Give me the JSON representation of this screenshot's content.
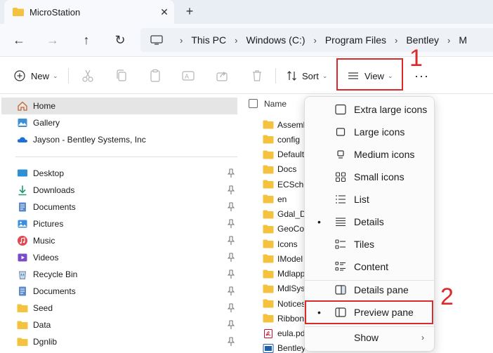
{
  "tab": {
    "title": "MicroStation",
    "close": "✕",
    "new_tab": "+"
  },
  "nav": {
    "back": "←",
    "forward": "→",
    "up": "↑",
    "refresh": "↻"
  },
  "breadcrumbs": [
    "This PC",
    "Windows (C:)",
    "Program Files",
    "Bentley",
    "M"
  ],
  "toolbar": {
    "new_label": "New",
    "sort_label": "Sort",
    "view_label": "View",
    "more_label": "···"
  },
  "annotations": {
    "step1": "1",
    "step2": "2"
  },
  "navpane": {
    "items": [
      {
        "label": "Home",
        "icon": "home-icon",
        "selected": true,
        "pinned": false
      },
      {
        "label": "Gallery",
        "icon": "gallery-icon",
        "pinned": false
      },
      {
        "label": "Jayson - Bentley Systems, Inc",
        "icon": "onedrive-icon",
        "pinned": false
      },
      {
        "label": "Desktop",
        "icon": "desktop-icon",
        "pinned": true
      },
      {
        "label": "Downloads",
        "icon": "downloads-icon",
        "pinned": true
      },
      {
        "label": "Documents",
        "icon": "documents-icon",
        "pinned": true
      },
      {
        "label": "Pictures",
        "icon": "pictures-icon",
        "pinned": true
      },
      {
        "label": "Music",
        "icon": "music-icon",
        "pinned": true
      },
      {
        "label": "Videos",
        "icon": "videos-icon",
        "pinned": true
      },
      {
        "label": "Recycle Bin",
        "icon": "recycle-bin-icon",
        "pinned": true
      },
      {
        "label": "Documents",
        "icon": "documents-icon",
        "pinned": true
      },
      {
        "label": "Seed",
        "icon": "folder-icon",
        "pinned": true
      },
      {
        "label": "Data",
        "icon": "folder-icon",
        "pinned": true
      },
      {
        "label": "Dgnlib",
        "icon": "folder-icon",
        "pinned": true
      }
    ]
  },
  "filelist": {
    "header": "Name",
    "rows": [
      {
        "name": "Assemb",
        "icon": "folder-icon"
      },
      {
        "name": "config",
        "icon": "folder-icon"
      },
      {
        "name": "Default",
        "icon": "folder-icon"
      },
      {
        "name": "Docs",
        "icon": "folder-icon"
      },
      {
        "name": "ECSche",
        "icon": "folder-icon"
      },
      {
        "name": "en",
        "icon": "folder-icon"
      },
      {
        "name": "Gdal_D",
        "icon": "folder-icon"
      },
      {
        "name": "GeoCo",
        "icon": "folder-icon"
      },
      {
        "name": "Icons",
        "icon": "folder-icon"
      },
      {
        "name": "IModel",
        "icon": "folder-icon"
      },
      {
        "name": "Mdlapp",
        "icon": "folder-icon"
      },
      {
        "name": "MdlSys",
        "icon": "folder-icon"
      },
      {
        "name": "Notices",
        "icon": "folder-icon"
      },
      {
        "name": "Ribbon",
        "icon": "folder-icon"
      },
      {
        "name": "eula.pd",
        "icon": "pdf-icon"
      },
      {
        "name": "Bentley",
        "icon": "app-icon"
      }
    ]
  },
  "view_menu": {
    "items": [
      {
        "label": "Extra large icons",
        "icon": "extra-large-icons-icon",
        "checked": false
      },
      {
        "label": "Large icons",
        "icon": "large-icons-icon",
        "checked": false
      },
      {
        "label": "Medium icons",
        "icon": "medium-icons-icon",
        "checked": false
      },
      {
        "label": "Small icons",
        "icon": "small-icons-icon",
        "checked": false
      },
      {
        "label": "List",
        "icon": "list-icon",
        "checked": false
      },
      {
        "label": "Details",
        "icon": "details-icon",
        "checked": true
      },
      {
        "label": "Tiles",
        "icon": "tiles-icon",
        "checked": false
      },
      {
        "label": "Content",
        "icon": "content-icon",
        "checked": false
      },
      {
        "label": "Details pane",
        "icon": "details-pane-icon",
        "checked": false
      },
      {
        "label": "Preview pane",
        "icon": "preview-pane-icon",
        "checked": true
      },
      {
        "label": "Show",
        "icon": "",
        "checked": false,
        "submenu": "›"
      }
    ],
    "bullet": "•"
  },
  "colors": {
    "highlight_red": "#d92b2b",
    "folder_yellow": "#f4c23f",
    "selected_bg": "#e5e5e5"
  }
}
